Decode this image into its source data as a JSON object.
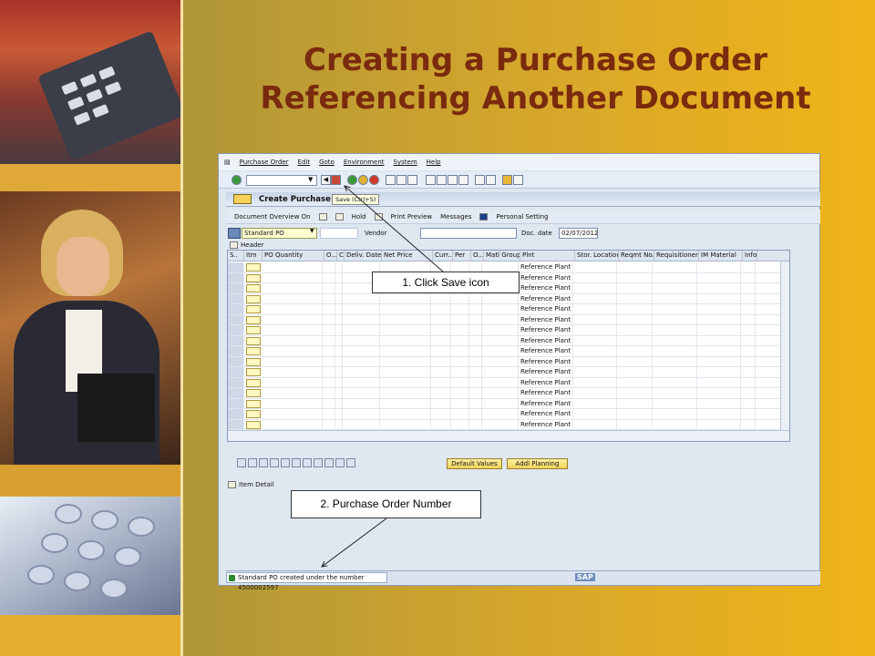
{
  "slide": {
    "title_line1": "Creating a Purchase Order",
    "title_line2": "Referencing Another Document"
  },
  "sap": {
    "menu": [
      "Purchase Order",
      "Edit",
      "Goto",
      "Environment",
      "System",
      "Help"
    ],
    "window_title": "Create Purchase O",
    "tooltip": "Save   (Ctrl+S)",
    "app_toolbar": [
      "Document Overview On",
      "Hold",
      "Print Preview",
      "Messages",
      "Personal Setting"
    ],
    "doc_type": "Standard PO",
    "vendor_label": "Vendor",
    "doc_date_label": "Doc. date",
    "doc_date": "02/07/2012",
    "header_label": "Header",
    "columns": [
      "S..",
      "Itm",
      "PO Quantity",
      "O...",
      "C",
      "Deliv. Date",
      "Net Price",
      "Curr...",
      "Per",
      "O...",
      "Matl Group",
      "Plnt",
      "Stor. Location",
      "Reqmt No.",
      "Requisitioner",
      "IM Material",
      "Info"
    ],
    "plant_value": "Reference Plant",
    "row_count": 17,
    "buttons": [
      "Default Values",
      "Addl Planning"
    ],
    "item_detail_label": "Item Detail",
    "status_message": "Standard PO created under the number 4500002597",
    "logo": "SAP"
  },
  "callouts": {
    "save": "1.  Click Save icon",
    "po_number": "2.   Purchase Order Number"
  },
  "colors": {
    "title": "#7a2a0e",
    "background_accent": "#f0b418"
  }
}
